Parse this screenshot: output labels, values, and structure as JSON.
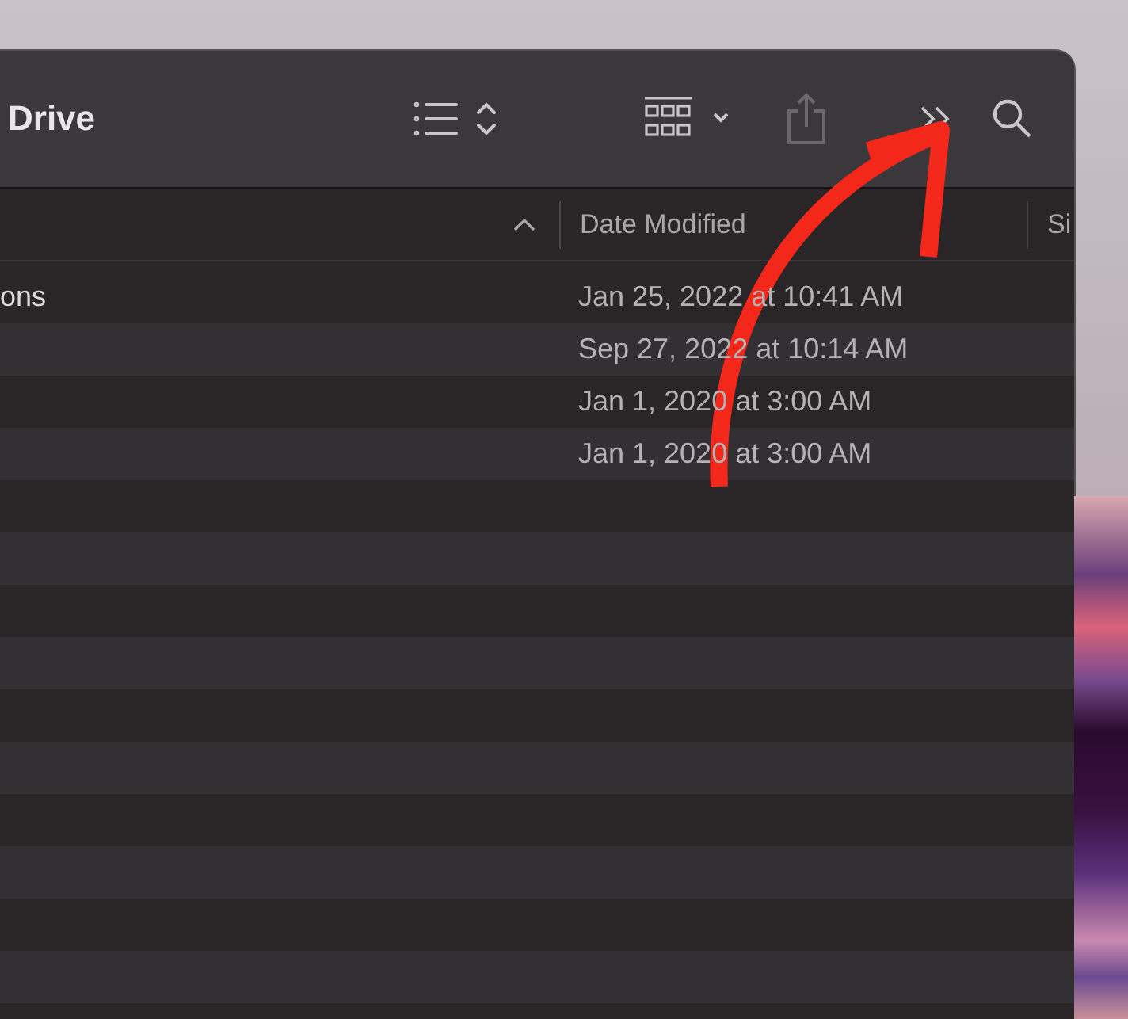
{
  "window": {
    "title": "Drive"
  },
  "table": {
    "columns": [
      {
        "label": "Date Modified"
      },
      {
        "label": "Si"
      }
    ],
    "rows": [
      {
        "name": "ons",
        "date_modified": "Jan 25, 2022 at 10:41 AM"
      },
      {
        "name": "",
        "date_modified": "Sep 27, 2022 at 10:14 AM"
      },
      {
        "name": "",
        "date_modified": "Jan 1, 2020 at 3:00 AM"
      },
      {
        "name": "",
        "date_modified": "Jan 1, 2020 at 3:00 AM"
      }
    ]
  }
}
